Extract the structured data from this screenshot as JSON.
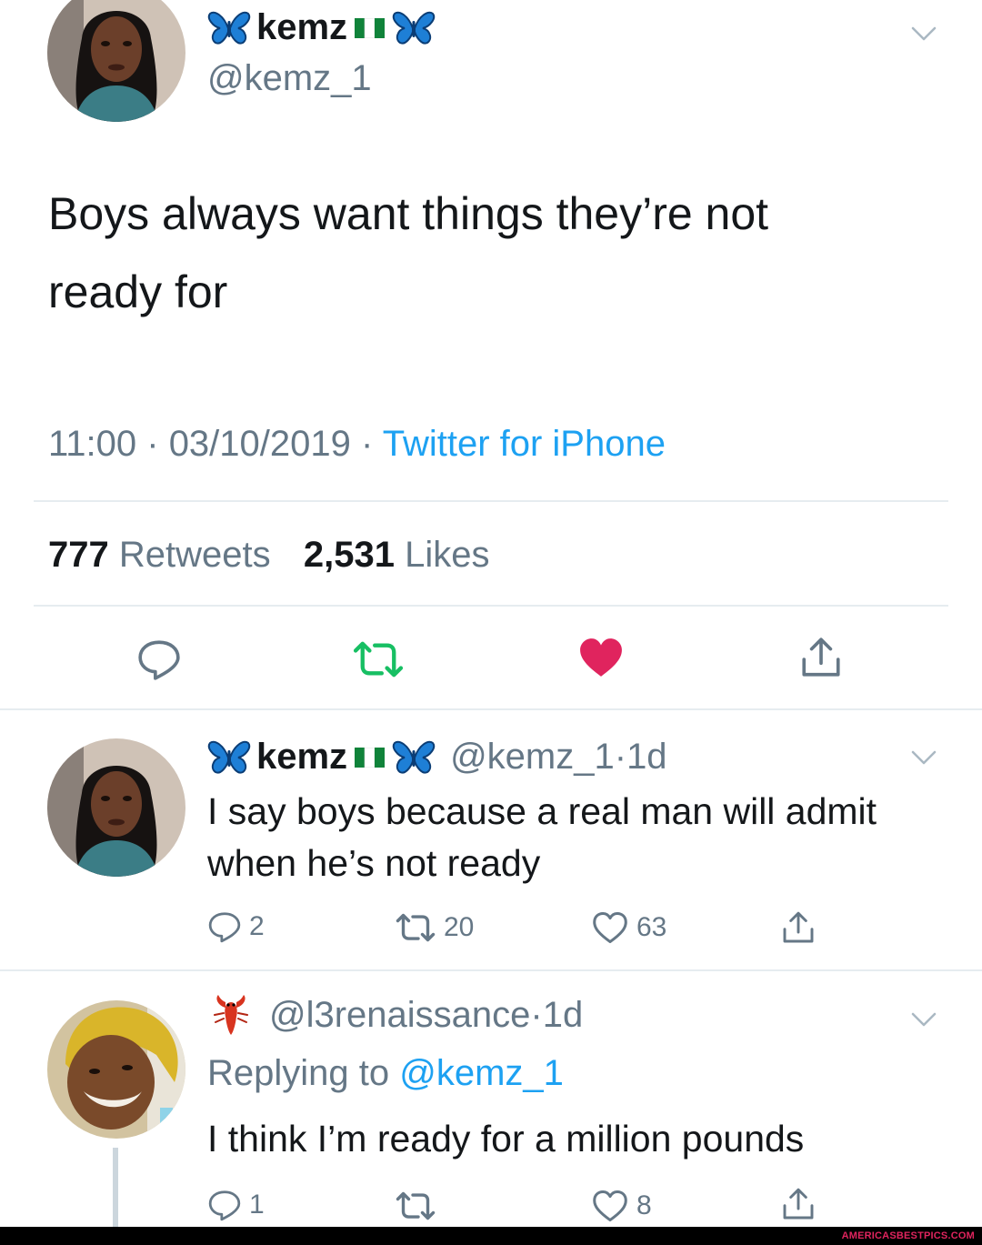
{
  "main_tweet": {
    "display_name": "kemz",
    "handle": "@kemz_1",
    "text_line1": "Boys always want things they’re not",
    "text_line2": "ready for",
    "time": "11:00",
    "date": "03/10/2019",
    "source": "Twitter for iPhone",
    "retweet_count": "777",
    "retweet_label": "Retweets",
    "like_count": "2,531",
    "like_label": "Likes",
    "liked": true,
    "retweeted": true
  },
  "reply1": {
    "display_name": "kemz",
    "handle": "@kemz_1",
    "age": "1d",
    "text_line1": "I say boys because a real man will admit",
    "text_line2": "when he’s not ready",
    "replies": "2",
    "retweets": "20",
    "likes": "63"
  },
  "reply2": {
    "handle": "@l3renaissance",
    "age": "1d",
    "replying_label": "Replying to",
    "replying_handle": "@kemz_1",
    "text": "I think I’m ready for a million pounds",
    "replies": "1",
    "likes": "8"
  },
  "watermark": "AMERICASBESTPICS.COM",
  "colors": {
    "accent": "#1da1f2",
    "like": "#e0245e",
    "retweet": "#17bf63",
    "secondary": "#657786"
  },
  "icons": [
    "butterfly-icon",
    "nigeria-flag-icon",
    "lobster-icon",
    "chevron-down-icon",
    "reply-icon",
    "retweet-icon",
    "heart-icon",
    "share-icon"
  ]
}
